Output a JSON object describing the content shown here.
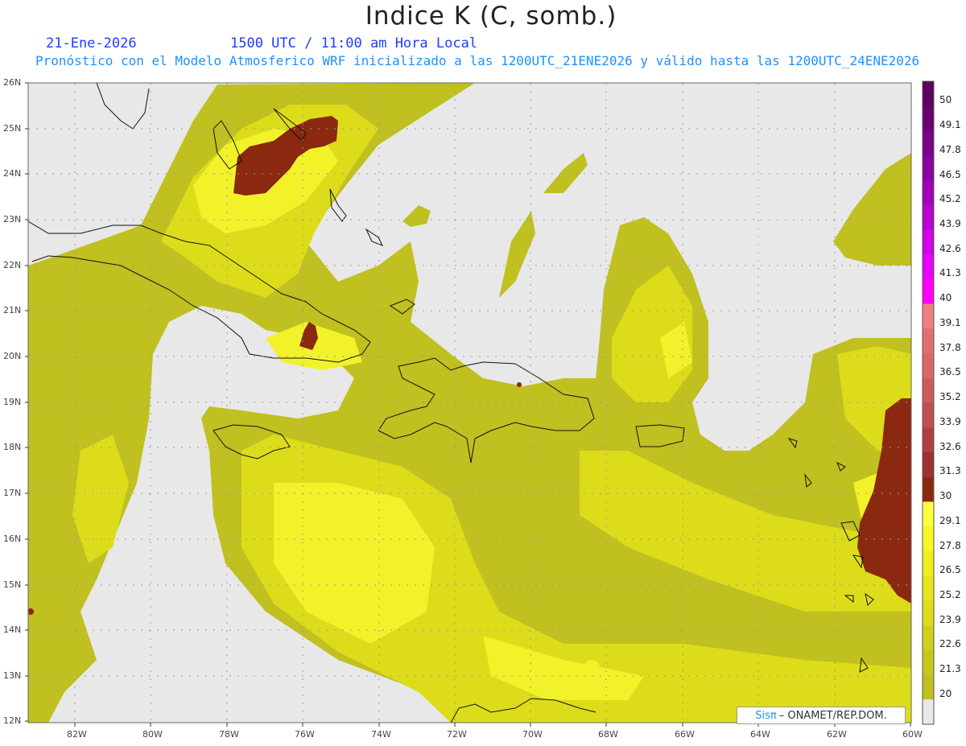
{
  "header": {
    "title": "Indice K (C, somb.)",
    "date": "21-Ene-2026",
    "time": "1500 UTC / 11:00 am Hora Local",
    "subtitle": "Pronóstico con el Modelo Atmosferico WRF inicializado a las 1200UTC_21ENE2026 y válido hasta las  1200UTC_24ENE2026"
  },
  "map": {
    "lat_labels": [
      "26N",
      "25N",
      "24N",
      "23N",
      "22N",
      "21N",
      "20N",
      "19N",
      "18N",
      "17N",
      "16N",
      "15N",
      "14N",
      "13N",
      "12N"
    ],
    "lon_labels": [
      "82W",
      "80W",
      "78W",
      "76W",
      "74W",
      "72W",
      "70W",
      "68W",
      "66W",
      "64W",
      "62W",
      "60W"
    ],
    "lat_range": [
      12,
      26
    ],
    "lon_range": [
      -83.2,
      -60
    ],
    "grid": true
  },
  "colorbar": {
    "labels": [
      "50",
      "49.1",
      "47.8",
      "46.5",
      "45.2",
      "43.9",
      "42.6",
      "41.3",
      "40",
      "39.1",
      "37.8",
      "36.5",
      "35.2",
      "33.9",
      "32.6",
      "31.3",
      "30",
      "29.1",
      "27.8",
      "26.5",
      "25.2",
      "23.9",
      "22.6",
      "21.3",
      "20"
    ],
    "colors_top_to_bottom": [
      "#5e0060",
      "#6a0070",
      "#7a0088",
      "#8a00a0",
      "#a000b8",
      "#b800d0",
      "#d000e8",
      "#e800ff",
      "#ff00ff",
      "#f08080",
      "#e07070",
      "#d86868",
      "#cc5c5c",
      "#c05050",
      "#b04040",
      "#a03030",
      "#8a2810",
      "#ffff40",
      "#f6f628",
      "#eeee20",
      "#e6e61a",
      "#dcdc1a",
      "#d0d01a",
      "#c8c81a",
      "#c0c020"
    ],
    "below_min_color": "#e8e8e8"
  },
  "credit": {
    "logo": "Sisπ",
    "text": "– ONAMET/REP.DOM."
  }
}
